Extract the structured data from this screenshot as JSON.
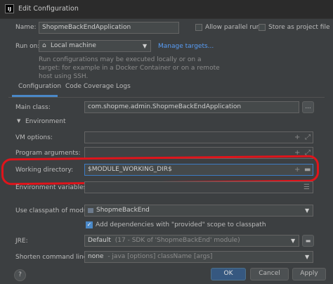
{
  "window": {
    "title": "Edit Configuration",
    "app_icon": "IJ"
  },
  "name_row": {
    "label": "Name:",
    "value": "ShopmeBackEndApplication",
    "allow_parallel": "Allow parallel run",
    "store_project": "Store as project file"
  },
  "run_on": {
    "label": "Run on:",
    "value": "Local machine",
    "manage": "Manage targets...",
    "description": "Run configurations may be executed locally or on a target: for example in a Docker Container or on a remote host using SSH."
  },
  "tabs": [
    {
      "label": "Configuration"
    },
    {
      "label": "Code Coverage"
    },
    {
      "label": "Logs"
    }
  ],
  "main_class": {
    "label": "Main class:",
    "value": "com.shopme.admin.ShopmeBackEndApplication",
    "browse": "..."
  },
  "environment": {
    "label": "Environment"
  },
  "vm_options": {
    "label": "VM options:"
  },
  "program_args": {
    "label": "Program arguments:"
  },
  "working_dir": {
    "label": "Working directory:",
    "value": "$MODULE_WORKING_DIR$"
  },
  "env_vars": {
    "label": "Environment variables:"
  },
  "classpath": {
    "label": "Use classpath of module:",
    "value": "ShopmeBackEnd"
  },
  "add_deps": {
    "label": "Add dependencies with \"provided\" scope to classpath"
  },
  "jre": {
    "label": "JRE:",
    "value": "Default",
    "hint": "(17 - SDK of 'ShopmeBackEnd' module)"
  },
  "shorten": {
    "label": "Shorten command line:",
    "value": "none",
    "hint": "- java [options] className [args]"
  },
  "footer": {
    "ok": "OK",
    "cancel": "Cancel",
    "apply": "Apply",
    "help": "?"
  },
  "colors": {
    "accent": "#4a88c7",
    "annotation": "#e0141b",
    "background": "#3c3f41"
  }
}
